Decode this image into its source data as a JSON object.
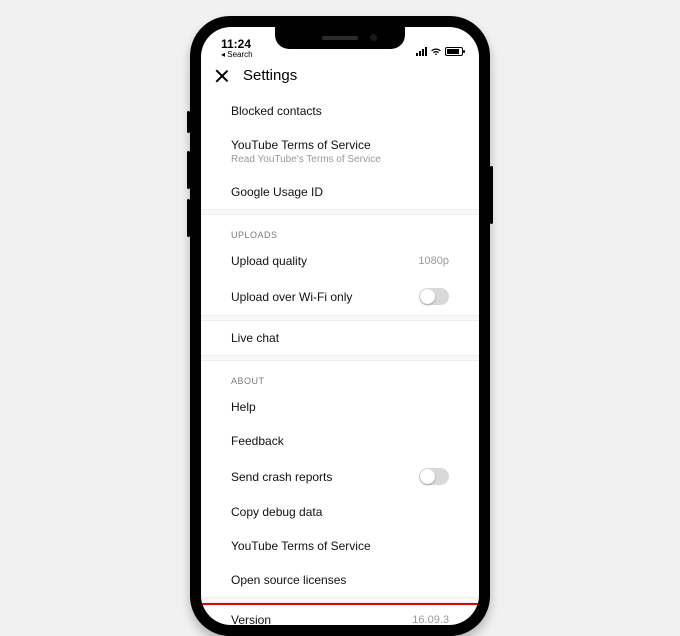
{
  "status": {
    "time": "11:24",
    "back": "◂ Search"
  },
  "header": {
    "title": "Settings",
    "close_icon": "close"
  },
  "rows": {
    "blocked": "Blocked contacts",
    "tos1": "YouTube Terms of Service",
    "tos1_sub": "Read YouTube's Terms of Service",
    "usage_id": "Google Usage ID",
    "uploads_head": "UPLOADS",
    "upload_quality": "Upload quality",
    "upload_quality_val": "1080p",
    "wifi_only": "Upload over Wi-Fi only",
    "live_chat": "Live chat",
    "about_head": "ABOUT",
    "help": "Help",
    "feedback": "Feedback",
    "crash": "Send crash reports",
    "copy_debug": "Copy debug data",
    "tos2": "YouTube Terms of Service",
    "licenses": "Open source licenses",
    "version": "Version",
    "version_val": "16.09.3"
  }
}
